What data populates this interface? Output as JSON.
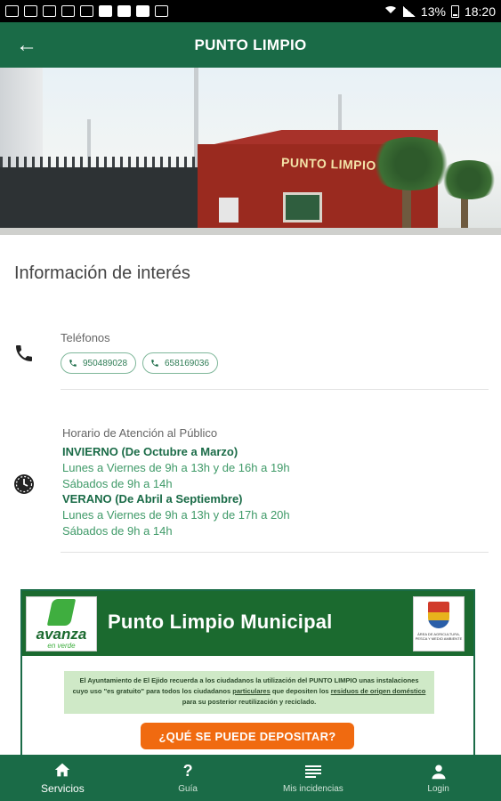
{
  "statusbar": {
    "battery": "13%",
    "time": "18:20",
    "icons": [
      "whatsapp-icon",
      "gallery-icon",
      "crossed-tools-icon",
      "chrome-icon",
      "drive-icon",
      "warning-icon",
      "photo-icon",
      "app-icon",
      "wifi-icon",
      "signal-icon",
      "battery-icon"
    ]
  },
  "appbar": {
    "title": "PUNTO LIMPIO",
    "back_icon": "arrow-left-icon"
  },
  "hero": {
    "sign_text": "PUNTO LIMPIO"
  },
  "info": {
    "title": "Información de interés",
    "phones": {
      "label": "Teléfonos",
      "numbers": [
        "950489028",
        "658169036"
      ]
    },
    "schedule": {
      "label": "Horario de Atención al Público",
      "lines": [
        "INVIERNO (De Octubre a Marzo)",
        "Lunes a Viernes de 9h a 13h y de 16h a 19h",
        "Sábados de 9h a 14h",
        "VERANO (De Abril a Septiembre)",
        "Lunes a Viernes de 9h a 13h y de 17h a 20h",
        "Sábados de 9h a 14h"
      ]
    }
  },
  "poster": {
    "logo_brand": "avanza",
    "logo_tag": "en verde",
    "title": "Punto Limpio Municipal",
    "crest_text": "ÁREA DE AGRICULTURA, PESCA Y MEDIO AMBIENTE",
    "msg_1": "El Ayuntamiento de El Ejido recuerda a los ciudadanos la utilización del  PUNTO LIMPIO  unas instalaciones cuyo uso \"es gratuito\" para todos los ciudadanos ",
    "msg_u1": "particulares",
    "msg_2": " que depositen los ",
    "msg_u2": "residuos de origen doméstico",
    "msg_3": " para su posterior reutilización y reciclado.",
    "cta": "¿QUÉ SE PUEDE DEPOSITAR?"
  },
  "bottomnav": {
    "items": [
      {
        "label": "Servicios",
        "icon": "home-icon"
      },
      {
        "label": "Guía",
        "icon": "help-icon"
      },
      {
        "label": "Mis incidencias",
        "icon": "list-icon"
      },
      {
        "label": "Login",
        "icon": "person-icon"
      }
    ]
  },
  "colors": {
    "primary": "#1a6b47",
    "accent": "#3f9a68",
    "orange": "#f06a10"
  }
}
